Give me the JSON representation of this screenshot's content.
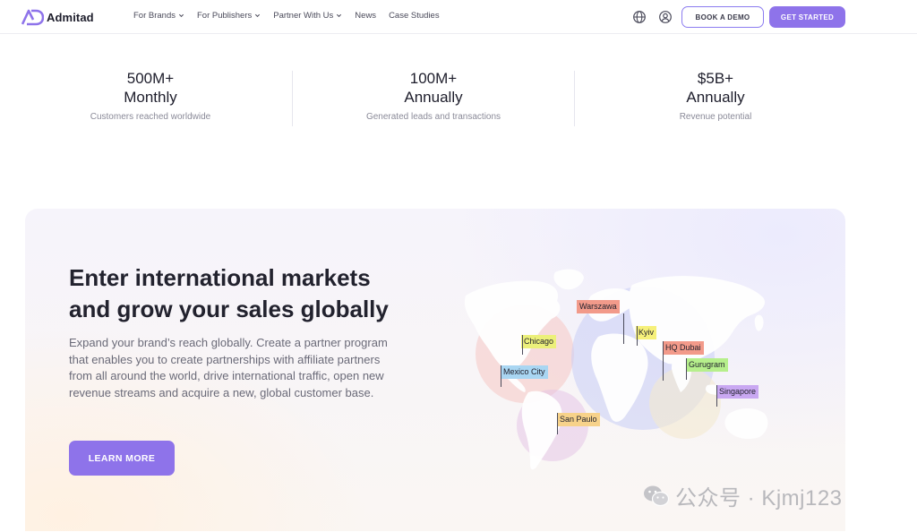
{
  "brand": {
    "name": "Admitad",
    "accent": "#8e73ea"
  },
  "nav": {
    "items": [
      {
        "label": "For Brands",
        "dropdown": true
      },
      {
        "label": "For Publishers",
        "dropdown": true
      },
      {
        "label": "Partner With Us",
        "dropdown": true
      },
      {
        "label": "News",
        "dropdown": false
      },
      {
        "label": "Case Studies",
        "dropdown": false
      }
    ],
    "icons": [
      "globe-icon",
      "user-icon"
    ],
    "book_demo": "BOOK A DEMO",
    "get_started": "GET STARTED"
  },
  "stats": [
    {
      "value": "500M+",
      "period": "Monthly",
      "desc": "Customers reached worldwide"
    },
    {
      "value": "100M+",
      "period": "Annually",
      "desc": "Generated leads and transactions"
    },
    {
      "value": "$5B+",
      "period": "Annually",
      "desc": "Revenue potential"
    }
  ],
  "hero": {
    "title_line1": "Enter international markets",
    "title_line2": "and grow your sales globally",
    "text": "Expand your brand’s reach globally. Create a partner program that enables you to create partnerships with affiliate partners from all around the world, drive international traffic, open new revenue streams and acquire a new, global customer base.",
    "button": "LEARN MORE"
  },
  "map": {
    "pins": [
      {
        "label": "Warszawa",
        "color": "#f29a8a"
      },
      {
        "label": "Kyiv",
        "color": "#f6f07a"
      },
      {
        "label": "Chicago",
        "color": "#ecf07a"
      },
      {
        "label": "HQ Dubai",
        "color": "#f29a8a"
      },
      {
        "label": "Gurugram",
        "color": "#b6ef8c"
      },
      {
        "label": "Mexico City",
        "color": "#a9d6f2"
      },
      {
        "label": "Singapore",
        "color": "#c9a8f2"
      },
      {
        "label": "San Paulo",
        "color": "#f7d28a"
      }
    ]
  },
  "watermark": {
    "text": "公众号 · Kjmj123",
    "icon": "wechat-icon"
  }
}
